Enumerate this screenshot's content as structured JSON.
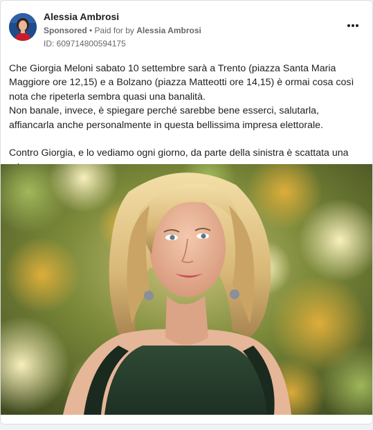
{
  "post": {
    "author_name": "Alessia Ambrosi",
    "sponsored_label": "Sponsored",
    "paid_for_prefix": " • Paid for by ",
    "payer_name": "Alessia Ambrosi",
    "ad_id": "ID: 609714800594175",
    "more_icon": "more-horizontal-icon",
    "paragraph_1": "Che Giorgia Meloni sabato 10 settembre sarà a Trento (piazza Santa Maria Maggiore ore 12,15) e a Bolzano (piazza Matteotti ore 14,15) è ormai cosa così nota che ripeterla sembra quasi una banalità.",
    "paragraph_2": "Non banale, invece, è spiegare perché sarebbe bene esserci, salutarla, affiancarla anche personalmente in questa bellissima impresa elettorale.",
    "paragraph_3": "Contro Giorgia, e lo vediamo ogni giorno, da parte della sinistra è scattata una tal…"
  },
  "colors": {
    "text_primary": "#1c1e21",
    "text_secondary": "#65676b",
    "card_border": "#dadde1",
    "avatar_bg": "#1f4c8c"
  }
}
